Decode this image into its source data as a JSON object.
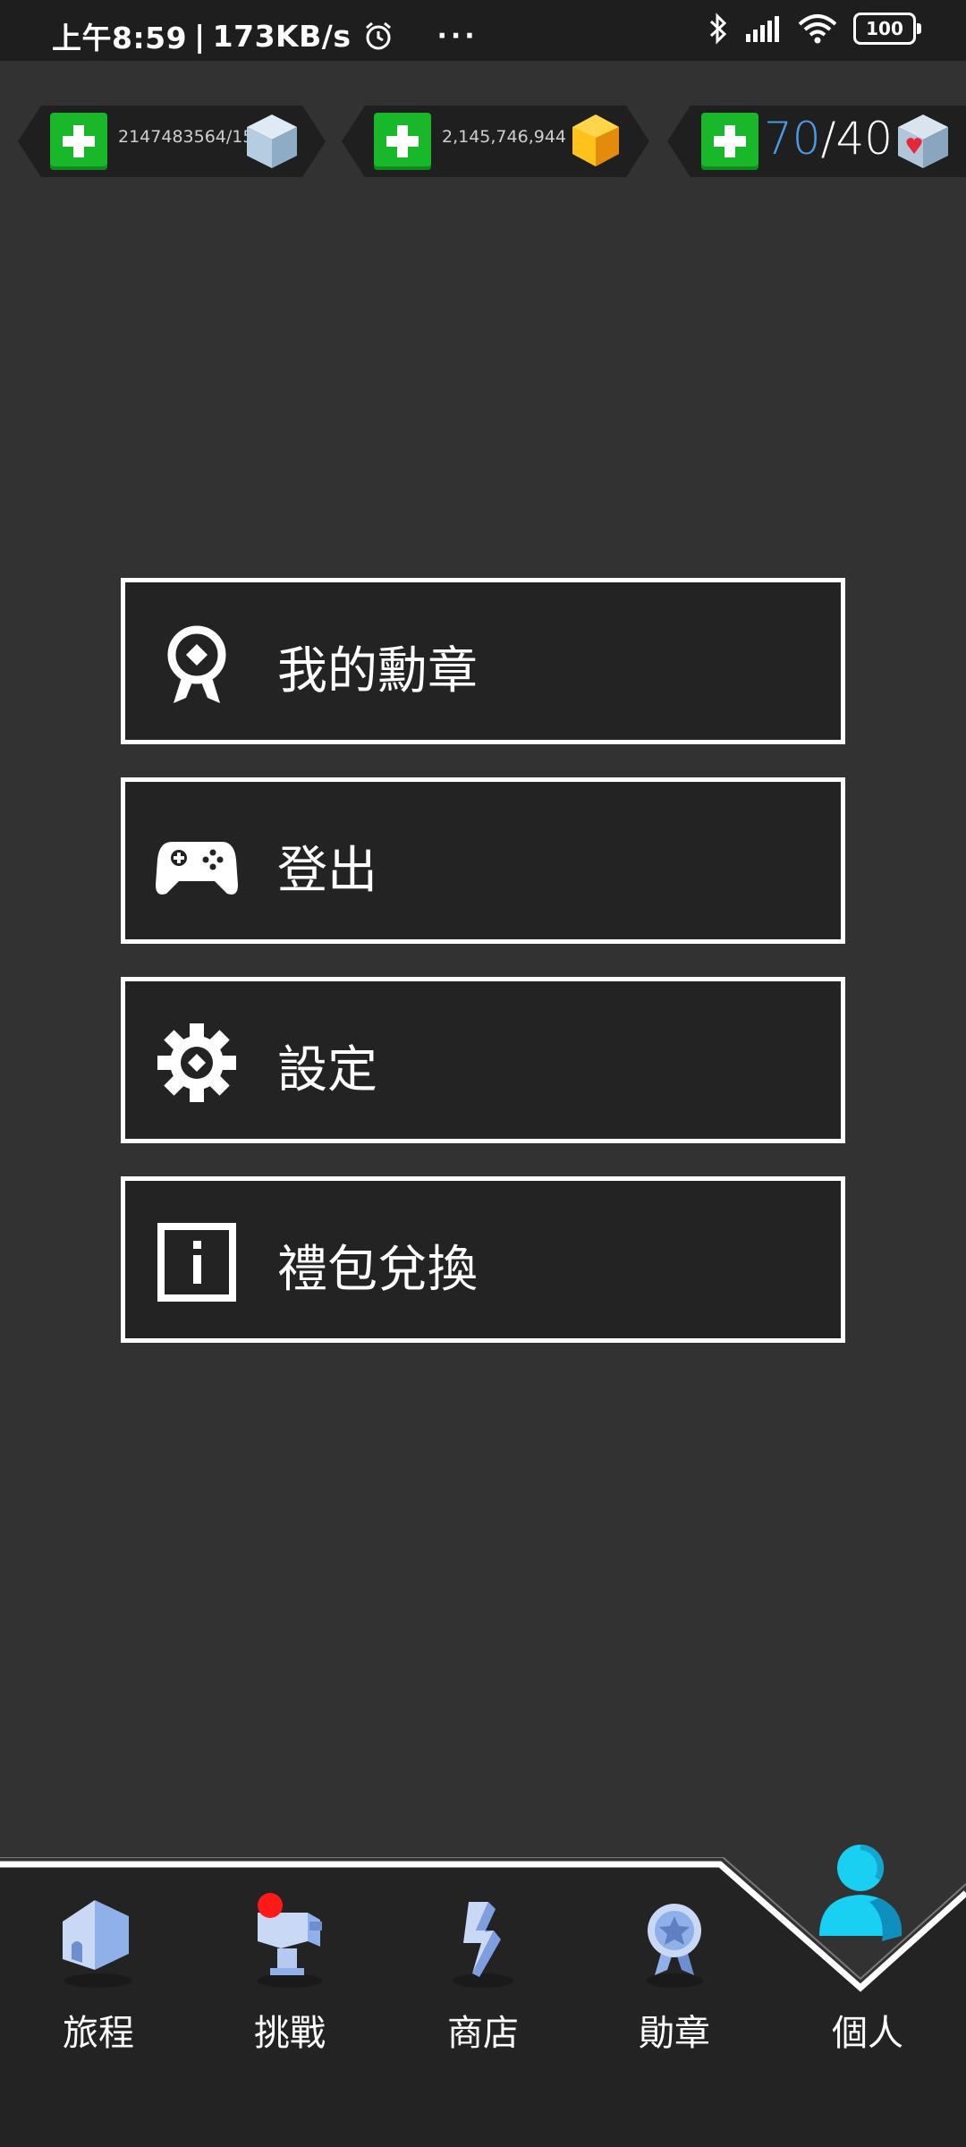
{
  "status_bar": {
    "time": "上午8:59",
    "separator": "|",
    "net_speed": "173KB/s",
    "more": "···",
    "battery": "100",
    "icons": [
      "alarm-icon",
      "bluetooth-icon",
      "signal-icon",
      "wifi-icon",
      "battery-icon"
    ]
  },
  "currencies": {
    "cubes": {
      "value": "2147483564/15",
      "icon": "blue-cube-icon"
    },
    "gold": {
      "value": "2,145,746,944",
      "icon": "gold-gem-icon"
    },
    "energy": {
      "current": "70",
      "separator": "/",
      "max": "40",
      "icon": "heart-cube-icon"
    }
  },
  "menu": {
    "items": [
      {
        "label": "我的勳章",
        "icon": "medal-icon"
      },
      {
        "label": "登出",
        "icon": "gamepad-icon"
      },
      {
        "label": "設定",
        "icon": "gear-icon"
      },
      {
        "label": "禮包兌換",
        "icon": "info-icon"
      }
    ]
  },
  "bottom_nav": {
    "items": [
      {
        "label": "旅程",
        "icon": "house-icon"
      },
      {
        "label": "挑戰",
        "icon": "trophy-icon",
        "badge": true
      },
      {
        "label": "商店",
        "icon": "shop-icon"
      },
      {
        "label": "勛章",
        "icon": "badge-icon"
      },
      {
        "label": "個人",
        "icon": "person-icon",
        "active": true
      }
    ]
  },
  "colors": {
    "background": "#323232",
    "panel": "#232323",
    "plus_green": "#18b82a",
    "energy_blue": "#4a9be8",
    "active_cyan": "#1ad0f2",
    "badge_red": "#ff1a1a"
  }
}
